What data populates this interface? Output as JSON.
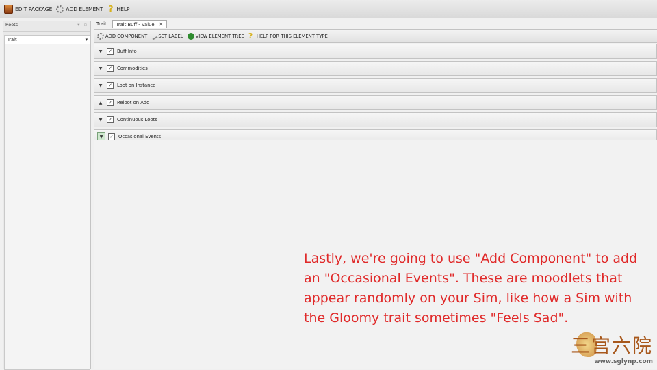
{
  "toolbar": {
    "edit_package": "EDIT PACKAGE",
    "add_element": "ADD ELEMENT",
    "help": "HELP"
  },
  "left_pane": {
    "header": "Roots",
    "items": [
      {
        "label": "Trait"
      }
    ]
  },
  "tabs": [
    {
      "label": "Trait"
    },
    {
      "label": "Trait Buff - Value"
    }
  ],
  "element_toolbar": {
    "add_component": "ADD COMPONENT",
    "set_label": "SET LABEL",
    "view_element_tree": "VIEW ELEMENT TREE",
    "help_for_type": "HELP FOR THIS ELEMENT TYPE"
  },
  "components": [
    {
      "label": "Buff Info",
      "checked": true
    },
    {
      "label": "Commodities",
      "checked": true
    },
    {
      "label": "Loot on Instance",
      "checked": true
    },
    {
      "label": "Reloot on Add",
      "checked": true
    },
    {
      "label": "Continuous Loots",
      "checked": true
    },
    {
      "label": "Occasional Events",
      "checked": true
    }
  ],
  "caption": {
    "line1": "Lastly, we're going to use \"Add Component\" to add",
    "line2": "an \"Occasional Events\". These are moodlets that",
    "line3": "appear randomly on your Sim, like how a Sim with",
    "line4": "the Gloomy trait sometimes \"Feels Sad\"."
  },
  "watermark": {
    "logo_text": "三宫六院",
    "url": "www.sglynp.com"
  },
  "colors": {
    "caption": "#e02a2a",
    "tree_icon": "#2e8b2e",
    "help_icon": "#d7b21e"
  }
}
